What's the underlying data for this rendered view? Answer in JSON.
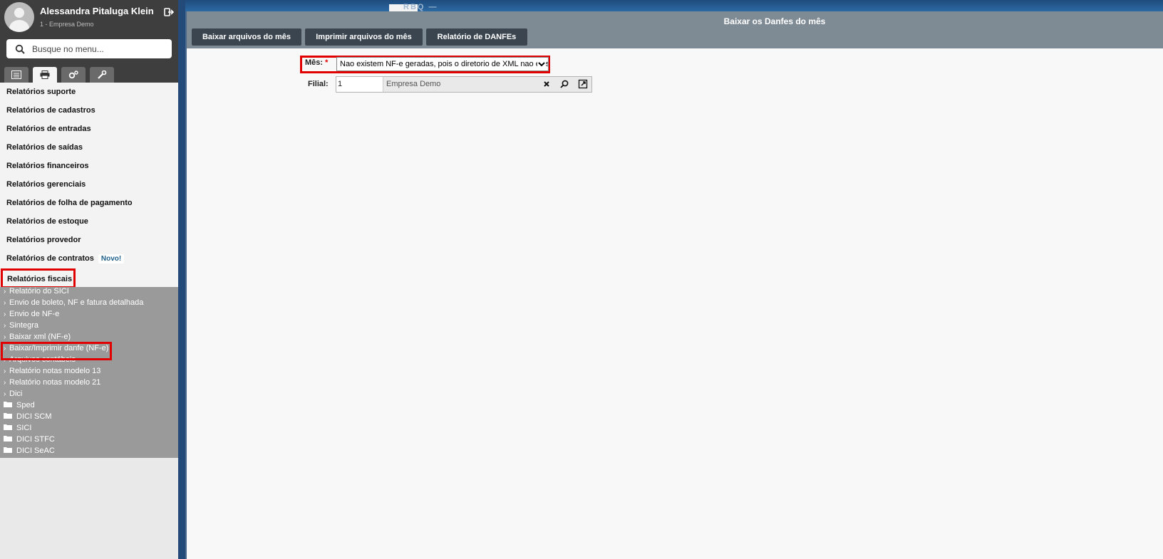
{
  "user": {
    "name": "Alessandra Pitaluga Klein",
    "company": "1 - Empresa Demo"
  },
  "search": {
    "placeholder": "Busque no menu..."
  },
  "sidebar_tabs": [
    "list-icon",
    "printer-icon",
    "gears-icon",
    "wrench-icon"
  ],
  "menu": {
    "items": [
      "Relatórios suporte",
      "Relatórios de cadastros",
      "Relatórios de entradas",
      "Relatórios de saídas",
      "Relatórios financeiros",
      "Relatórios gerenciais",
      "Relatórios de folha de pagamento",
      "Relatórios de estoque",
      "Relatórios provedor",
      "Relatórios de contratos"
    ],
    "new_badge": "Novo!",
    "active_section": "Relatórios fiscais"
  },
  "subtree": {
    "items": [
      "Relatório do SICI",
      "Envio de boleto, NF e fatura detalhada",
      "Envio de NF-e",
      "Sintegra",
      "Baixar xml (NF-e)",
      "Baixar/Imprimir danfe (NF-e)",
      "Arquivos contábeis",
      "Relatório notas modelo 13",
      "Relatório notas modelo 21",
      "Dici"
    ],
    "folders": [
      "Sped",
      "DICI SCM",
      "SICI",
      "DICI STFC",
      "DICI SeAC"
    ],
    "selected": "Baixar/Imprimir danfe (NF-e)"
  },
  "topbar": {
    "text": "RBQ —"
  },
  "window": {
    "title": "Baixar os Danfes do mês",
    "toolbar": [
      "Baixar arquivos do mês",
      "Imprimir arquivos do mês",
      "Relatório de DANFEs"
    ]
  },
  "form": {
    "mes_label": "Mês:",
    "required_mark": "*",
    "mes_value": "Nao existem NF-e geradas, pois o diretorio de XML nao existe",
    "filial_label": "Filial:",
    "filial_code": "1",
    "filial_name": "Empresa Demo"
  },
  "colors": {
    "highlight": "#e00000",
    "toolbar": "#3a4550",
    "title_bar": "#7e8a94",
    "sidebar_dark": "#3e3e3e"
  }
}
